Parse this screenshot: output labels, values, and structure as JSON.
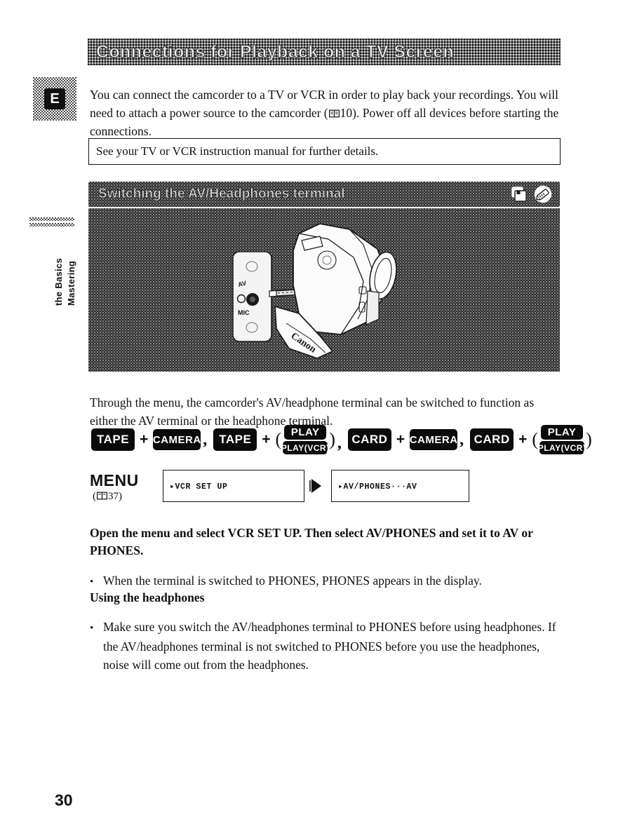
{
  "page": {
    "number": "30",
    "chapter_marker_line1": "Mastering",
    "chapter_marker_line2": "the Basics",
    "language_tab": "E"
  },
  "chapter": {
    "title": "Connections for Playback on a TV Screen"
  },
  "intro": {
    "text_before_ref": "You can connect the camcorder to a TV or VCR in order to play back your recordings. You will need to attach a power source to the camcorder (",
    "reference_page": "10",
    "text_after_ref": ").",
    "last_line": "Power off all devices before starting the connections."
  },
  "note_box": {
    "text": "See your TV or VCR instruction manual for further details."
  },
  "section": {
    "title": "Switching the AV/Headphones terminal",
    "icons": [
      "card-icon",
      "memory-card-pen-icon"
    ]
  },
  "illustration": {
    "caption_labels": [
      "AV",
      "MIC"
    ],
    "brand": "Canon",
    "alt": "Camcorder with AV/MIC terminal cover opened"
  },
  "terminal_paragraph": {
    "text": "Through the menu, the camcorder's AV/headphone terminal can be switched to function as either the AV terminal or the headphone terminal."
  },
  "mode_row": {
    "groups": [
      {
        "first": "TAPE",
        "second": "CAMERA",
        "second_stacked": null,
        "separator": ","
      },
      {
        "first": "TAPE",
        "second": "PLAY",
        "second_stacked": "PLAY(VCR)",
        "separator": ","
      },
      {
        "first": "CARD",
        "second": "CAMERA",
        "second_stacked": null,
        "separator": ","
      },
      {
        "first": "CARD",
        "second": "PLAY",
        "second_stacked": "PLAY(VCR)",
        "separator": ""
      }
    ],
    "plus": "+",
    "open_paren": "(",
    "close_paren": ")"
  },
  "menu_row": {
    "menu_label": "MENU",
    "menu_reference": "37",
    "screen_1": "VCR SET UP",
    "screen_2": "AV/PHONES···AV"
  },
  "instruction": {
    "bold_text": "Open the menu and select VCR SET UP. Then select AV/PHONES and set it to AV or PHONES.",
    "bullet": "When the terminal is switched to PHONES, PHONES appears in the display."
  },
  "headphones": {
    "heading": "Using the headphones",
    "bullet": "Make sure you switch the AV/headphones terminal to PHONES before using headphones. If the AV/headphones terminal is not switched to PHONES before you use the headphones, noise will come out from the headphones."
  },
  "colors": {
    "ink": "#111111",
    "paper": "#ffffff",
    "badge_bg": "#0b0b0b",
    "badge_text": "#ffffff"
  }
}
